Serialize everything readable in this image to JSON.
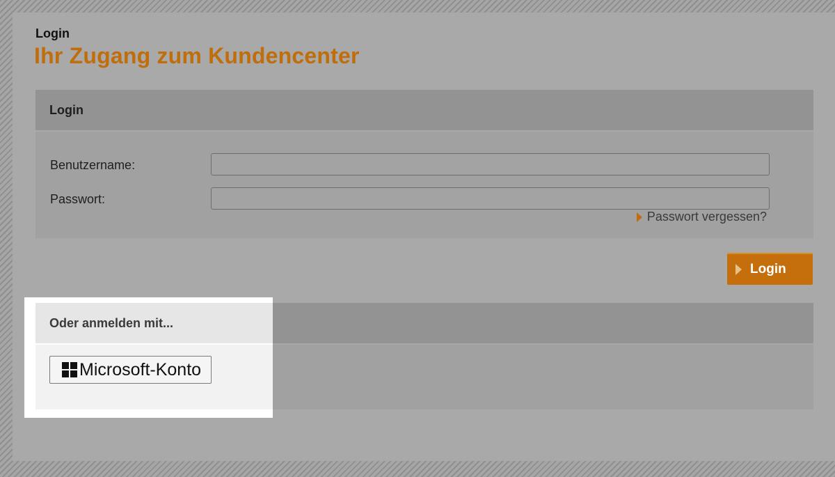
{
  "header": {
    "eyebrow": "Login",
    "headline": "Ihr Zugang zum Kundencenter"
  },
  "login_panel": {
    "title": "Login",
    "username_label": "Benutzername:",
    "username_value": "",
    "password_label": "Passwort:",
    "password_value": "",
    "forgot_link": "Passwort vergessen?",
    "submit_label": "Login"
  },
  "alt_login": {
    "title": "Oder anmelden mit...",
    "microsoft_label": "Microsoft-Konto"
  },
  "colors": {
    "accent": "#c06d0b",
    "button": "#c46f0c",
    "highlight": "#ffffff"
  },
  "icons": [
    "arrow-right-icon",
    "windows-logo-icon"
  ]
}
